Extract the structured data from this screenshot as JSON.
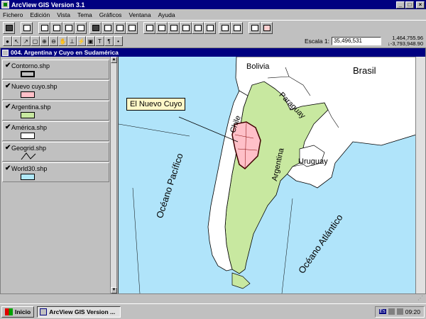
{
  "window": {
    "title": "ArcView GIS Version 3.1",
    "controls": {
      "minimize": "_",
      "maximize": "□",
      "close": "×"
    }
  },
  "menu": [
    "Fichero",
    "Edición",
    "Vista",
    "Tema",
    "Gráficos",
    "Ventana",
    "Ayuda"
  ],
  "toolbar": {
    "scale_label": "Escala 1:",
    "scale_value": "35,496,531",
    "coord_x": "1,464,755.96",
    "coord_y": "-3,793,948.90",
    "coord_y_arrow": "↓"
  },
  "document": {
    "title": "004. Argentina y Cuyo en Sudamérica"
  },
  "themes": [
    {
      "name": "Contorno.shp",
      "checked": "✔",
      "fill": "#ffffff",
      "symbol": "box-outline"
    },
    {
      "name": "Nuevo cuyo.shp",
      "checked": "✔",
      "fill": "#ffc0c8",
      "symbol": "polygon"
    },
    {
      "name": "Argentina.shp",
      "checked": "✔",
      "fill": "#c8e8a0",
      "symbol": "polygon"
    },
    {
      "name": "América.shp",
      "checked": "✔",
      "fill": "#ffffff",
      "symbol": "polygon"
    },
    {
      "name": "Geogrid.shp",
      "checked": "✔",
      "fill": "none",
      "symbol": "line"
    },
    {
      "name": "World30.shp",
      "checked": "✔",
      "fill": "#b0e8f8",
      "symbol": "polygon"
    }
  ],
  "map": {
    "labels": {
      "bolivia": "Bolivia",
      "brasil": "Brasil",
      "paraguay": "Paraguay",
      "chile": "Chile",
      "argentina": "Argentina",
      "uruguay": "Uruguay",
      "pacifico": "Océano Pacífico",
      "atlantico": "Océano Atlántico"
    },
    "callout": "El Nuevo Cuyo",
    "colors": {
      "ocean": "#b0e4fa",
      "land": "#ffffff",
      "argentina": "#c8e8a0",
      "cuyo": "#ffc0c8"
    }
  },
  "taskbar": {
    "start": "Inicio",
    "task": "ArcView GIS Version ...",
    "lang": "Es",
    "clock": "09:20"
  }
}
